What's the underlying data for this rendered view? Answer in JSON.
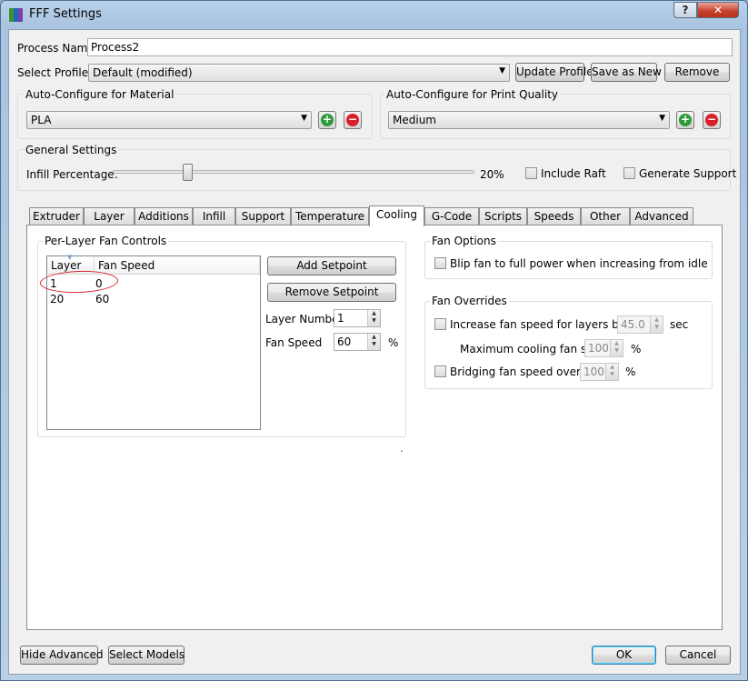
{
  "window": {
    "title": "FFF Settings",
    "help_label": "?",
    "close_label": "✕"
  },
  "process": {
    "label": "Process Name:",
    "value": "Process2"
  },
  "profile": {
    "label": "Select Profile:",
    "value": "Default (modified)",
    "update_label": "Update Profile",
    "save_new_label": "Save as New",
    "remove_label": "Remove"
  },
  "material": {
    "title": "Auto-Configure for Material",
    "value": "PLA",
    "add_label": "+",
    "remove_label": "−"
  },
  "quality": {
    "title": "Auto-Configure for Print Quality",
    "value": "Medium",
    "add_label": "+",
    "remove_label": "−"
  },
  "general": {
    "title": "General Settings",
    "infill_label": "Infill Percentage:",
    "infill_value_text": "20%",
    "infill_value": 20,
    "raft_label": "Include Raft",
    "support_label": "Generate Support"
  },
  "tabs": [
    {
      "label": "Extruder"
    },
    {
      "label": "Layer"
    },
    {
      "label": "Additions"
    },
    {
      "label": "Infill"
    },
    {
      "label": "Support"
    },
    {
      "label": "Temperature"
    },
    {
      "label": "Cooling",
      "active": true
    },
    {
      "label": "G-Code"
    },
    {
      "label": "Scripts"
    },
    {
      "label": "Speeds"
    },
    {
      "label": "Other"
    },
    {
      "label": "Advanced"
    }
  ],
  "cooling": {
    "fan_controls": {
      "title": "Per-Layer Fan Controls",
      "columns": [
        "Layer",
        "Fan Speed"
      ],
      "rows": [
        [
          "1",
          "0"
        ],
        [
          "20",
          "60"
        ]
      ],
      "add_label": "Add Setpoint",
      "remove_label": "Remove Setpoint",
      "layer_label": "Layer Number",
      "layer_value": "1",
      "speed_label": "Fan Speed",
      "speed_value": "60",
      "speed_unit": "%"
    },
    "fan_options": {
      "title": "Fan Options",
      "blip_label": "Blip fan to full power when increasing from idle"
    },
    "fan_overrides": {
      "title": "Fan Overrides",
      "increase_label": "Increase fan speed for layers below",
      "increase_value": "45.0",
      "increase_unit": "sec",
      "max_label": "Maximum cooling fan speed",
      "max_value": "100",
      "max_unit": "%",
      "bridging_label": "Bridging fan speed override",
      "bridging_value": "100",
      "bridging_unit": "%"
    },
    "dot": "."
  },
  "footer": {
    "hide_advanced_label": "Hide Advanced",
    "select_models_label": "Select Models",
    "ok_label": "OK",
    "cancel_label": "Cancel"
  },
  "colors": {
    "add_green": "#2f9a3c",
    "remove_red": "#d8202a",
    "annotation_red": "#d7262b",
    "icon_green": "#3f8f2f",
    "icon_blue": "#1f66b8",
    "icon_purple": "#7a3fa8"
  },
  "icons": {
    "app": "fff-app-icon",
    "add": "plus-circle-icon",
    "remove": "minus-circle-icon",
    "sort": "sort-indicator-icon",
    "dropdown": "chevron-down-icon",
    "spin_up": "spin-up-icon",
    "spin_down": "spin-down-icon"
  }
}
